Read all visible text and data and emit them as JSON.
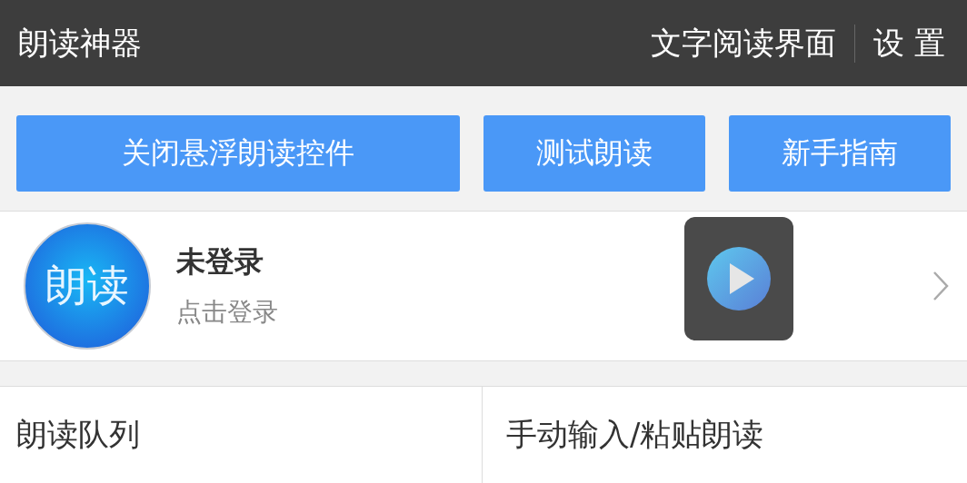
{
  "app_bar": {
    "title": "朗读神器",
    "actions": [
      {
        "label": "文字阅读界面"
      },
      {
        "label": "设 置"
      }
    ]
  },
  "buttons": [
    {
      "label": "关闭悬浮朗读控件"
    },
    {
      "label": "测试朗读"
    },
    {
      "label": "新手指南"
    }
  ],
  "profile": {
    "avatar_text": "朗读",
    "name": "未登录",
    "subtitle": "点击登录"
  },
  "menu": [
    {
      "label": "朗读队列"
    },
    {
      "label": "手动输入/粘贴朗读"
    }
  ]
}
